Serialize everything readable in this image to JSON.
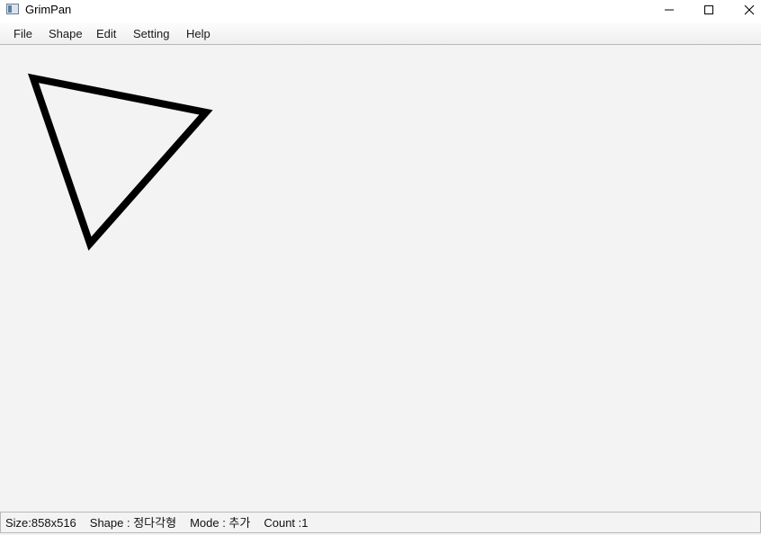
{
  "window": {
    "title": "GrimPan"
  },
  "menu": {
    "items": [
      "File",
      "Shape",
      "Edit",
      "Setting",
      "Help"
    ]
  },
  "canvas": {
    "shapes": [
      {
        "type": "triangle",
        "stroke": "#000000",
        "fill": "none"
      }
    ]
  },
  "status": {
    "size": "Size:858x516",
    "shape": "Shape : 정다각형",
    "mode": "Mode : 추가",
    "count": "Count :1"
  }
}
